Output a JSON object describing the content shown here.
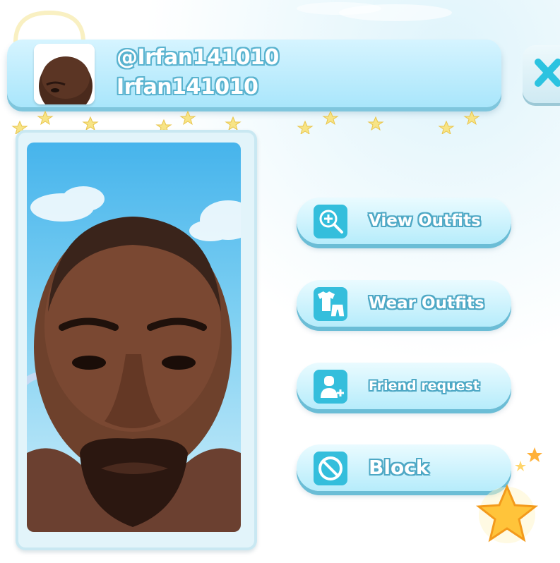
{
  "profile": {
    "username": "@Irfan141010",
    "display_name": "Irfan141010"
  },
  "actions": [
    {
      "label": "View Outfits",
      "icon": "magnifier-plus-icon"
    },
    {
      "label": "Wear Outfits",
      "icon": "shirt-shorts-icon"
    },
    {
      "label": "Friend request",
      "icon": "add-friend-icon"
    },
    {
      "label": "Block",
      "icon": "block-icon"
    }
  ],
  "close": {
    "icon": "close-icon"
  },
  "colors": {
    "banner": "#a9e6fb",
    "button_fill": "#b6ecfb",
    "icon_tile": "#34bedc",
    "label_outline": "#4ea8c5",
    "sky": "#46b4ec"
  }
}
